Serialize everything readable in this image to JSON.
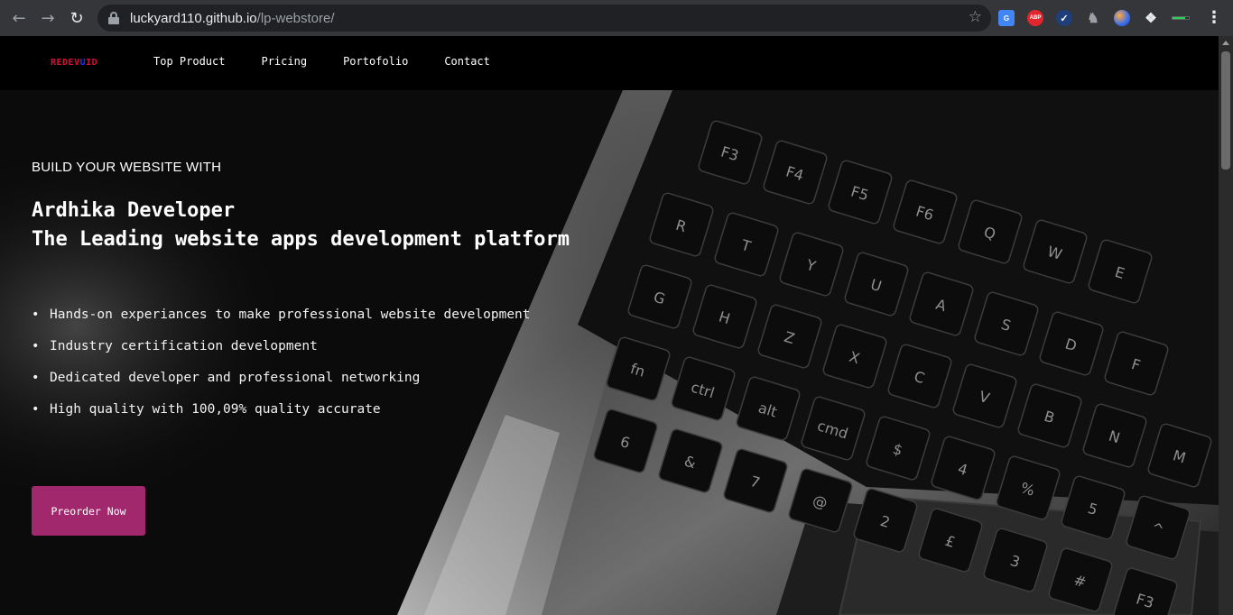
{
  "browser": {
    "url_host": "luckyard110.github.io",
    "url_path": "/lp-webstore/",
    "extensions": [
      "google-translate-icon",
      "adblock-plus-icon",
      "check-shield-icon",
      "puzzle-extension-icon",
      "globe-icon",
      "extensions-puzzle-icon",
      "battery-icon"
    ],
    "ext_labels": {
      "translate": "G",
      "abp": "ABP",
      "check": "✓"
    }
  },
  "site": {
    "logo": {
      "part1": "REDEV",
      "part2": "U",
      "part3": "ID"
    },
    "nav": [
      "Top Product",
      "Pricing",
      "Portofolio",
      "Contact"
    ]
  },
  "hero": {
    "eyebrow": "BUILD YOUR WEBSITE WITH",
    "headline_line1": "Ardhika Developer",
    "headline_line2": "The Leading website apps development platform",
    "features": [
      "Hands-on experiances to make professional website development",
      "Industry certification development",
      "Dedicated developer and professional networking",
      "High quality with 100,09% quality accurate"
    ],
    "cta_label": "Preorder Now"
  },
  "keyboard_keys": [
    "F3",
    "F4",
    "F5",
    "F6",
    "Q",
    "W",
    "E",
    "R",
    "T",
    "Y",
    "U",
    "A",
    "S",
    "D",
    "F",
    "G",
    "H",
    "Z",
    "X",
    "C",
    "V",
    "B",
    "N",
    "M",
    "fn",
    "ctrl",
    "alt",
    "cmd",
    "$",
    "4",
    "%",
    "5",
    "^",
    "6",
    "&",
    "7",
    "@",
    "2",
    "£",
    "3",
    "#"
  ],
  "colors": {
    "cta": "#a2286d",
    "logo_red": "#d6113a",
    "logo_blue": "#2b2bf5",
    "nav_bg": "#000000"
  }
}
